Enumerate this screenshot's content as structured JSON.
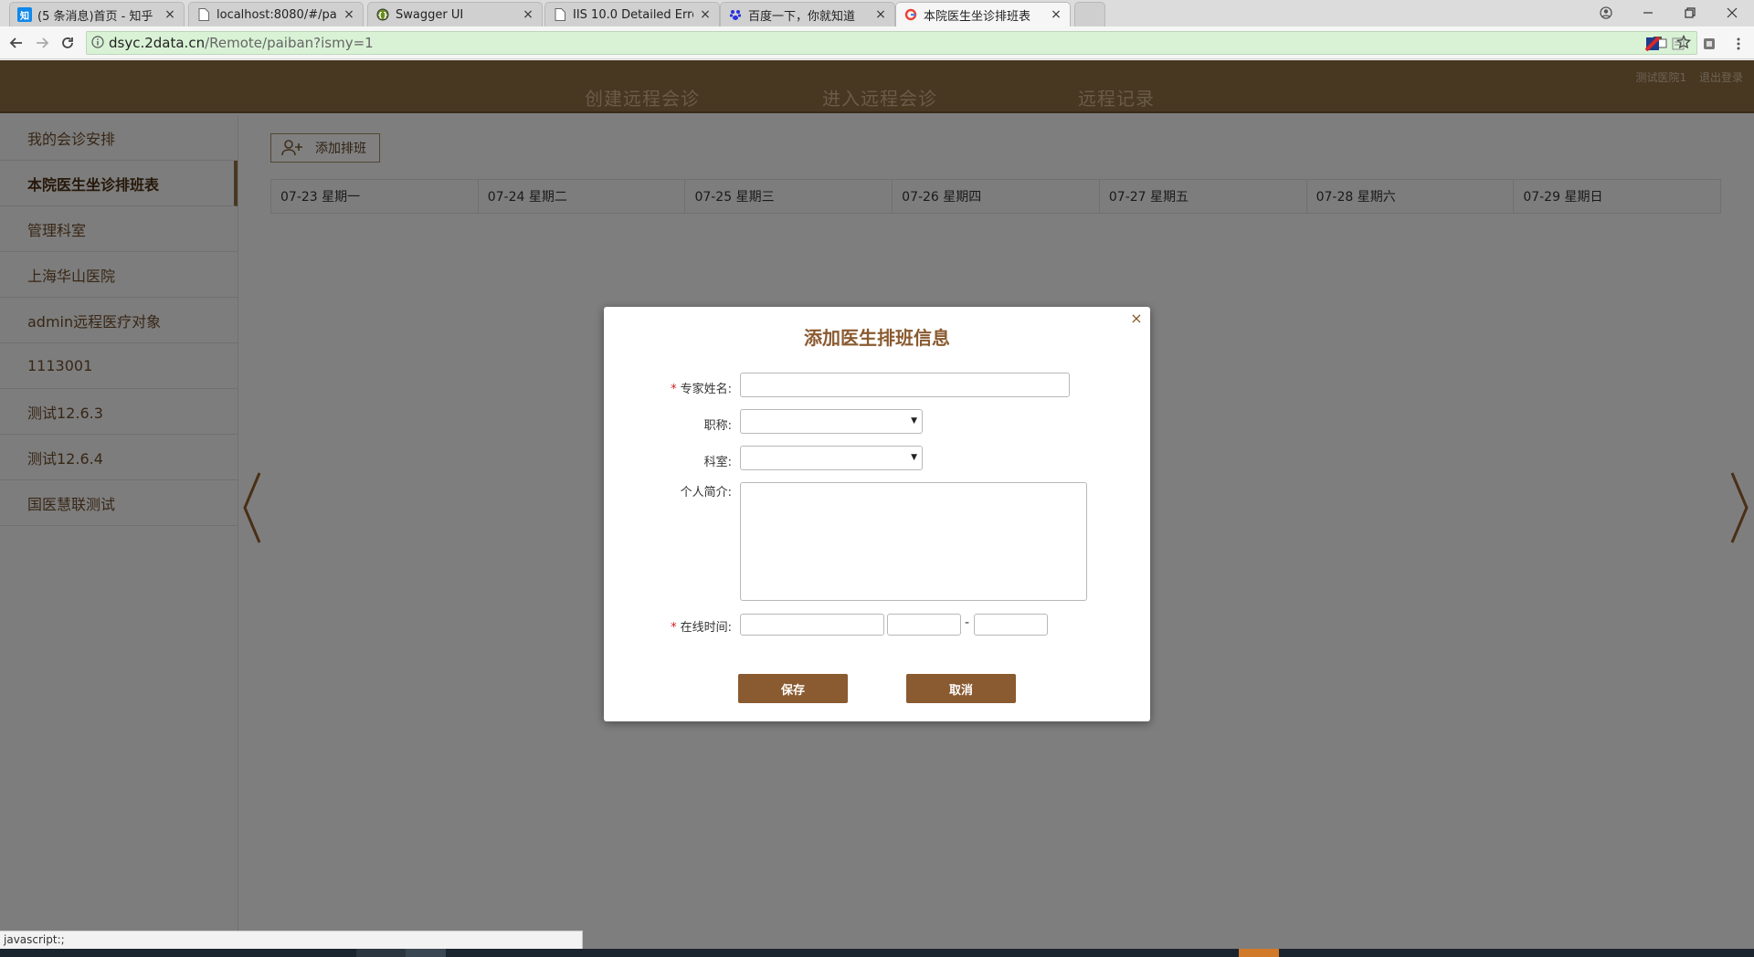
{
  "browser": {
    "tabs": [
      {
        "title": "(5 条消息)首页 - 知乎",
        "favicon": "知"
      },
      {
        "title": "localhost:8080/#/pad/c",
        "favicon": ""
      },
      {
        "title": "Swagger UI",
        "favicon": ""
      },
      {
        "title": "IIS 10.0 Detailed Error -",
        "favicon": ""
      },
      {
        "title": "百度一下，你就知道",
        "favicon": ""
      },
      {
        "title": "本院医生坐诊排班表",
        "favicon": ""
      }
    ],
    "close_glyph": "×",
    "url_host": "dsyc.2data.cn",
    "url_path": "/Remote/paiban?ismy=1",
    "status_text": "javascript:;"
  },
  "header": {
    "nav": [
      "创建远程会诊",
      "进入远程会诊",
      "远程记录"
    ],
    "user": "测试医院1",
    "logout": "退出登录"
  },
  "sidebar": {
    "items": [
      "我的会诊安排",
      "本院医生坐诊排班表",
      "管理科室",
      "上海华山医院",
      "admin远程医疗对象",
      "1113001",
      "测试12.6.3",
      "测试12.6.4",
      "国医慧联测试"
    ]
  },
  "main": {
    "add_label": "添加排班",
    "days": [
      "07-23 星期一",
      "07-24 星期二",
      "07-25 星期三",
      "07-26 星期四",
      "07-27 星期五",
      "07-28 星期六",
      "07-29 星期日"
    ]
  },
  "modal": {
    "title": "添加医生排班信息",
    "close": "×",
    "req_mark": "*",
    "name_label": "专家姓名:",
    "title_label": "职称:",
    "dept_label": "科室:",
    "bio_label": "个人简介:",
    "time_label": "在线时间:",
    "time_sep": "-",
    "save": "保存",
    "cancel": "取消"
  },
  "colors": {
    "brand": "#8a6a40",
    "accent": "#8a5a30",
    "required": "#d02020"
  }
}
